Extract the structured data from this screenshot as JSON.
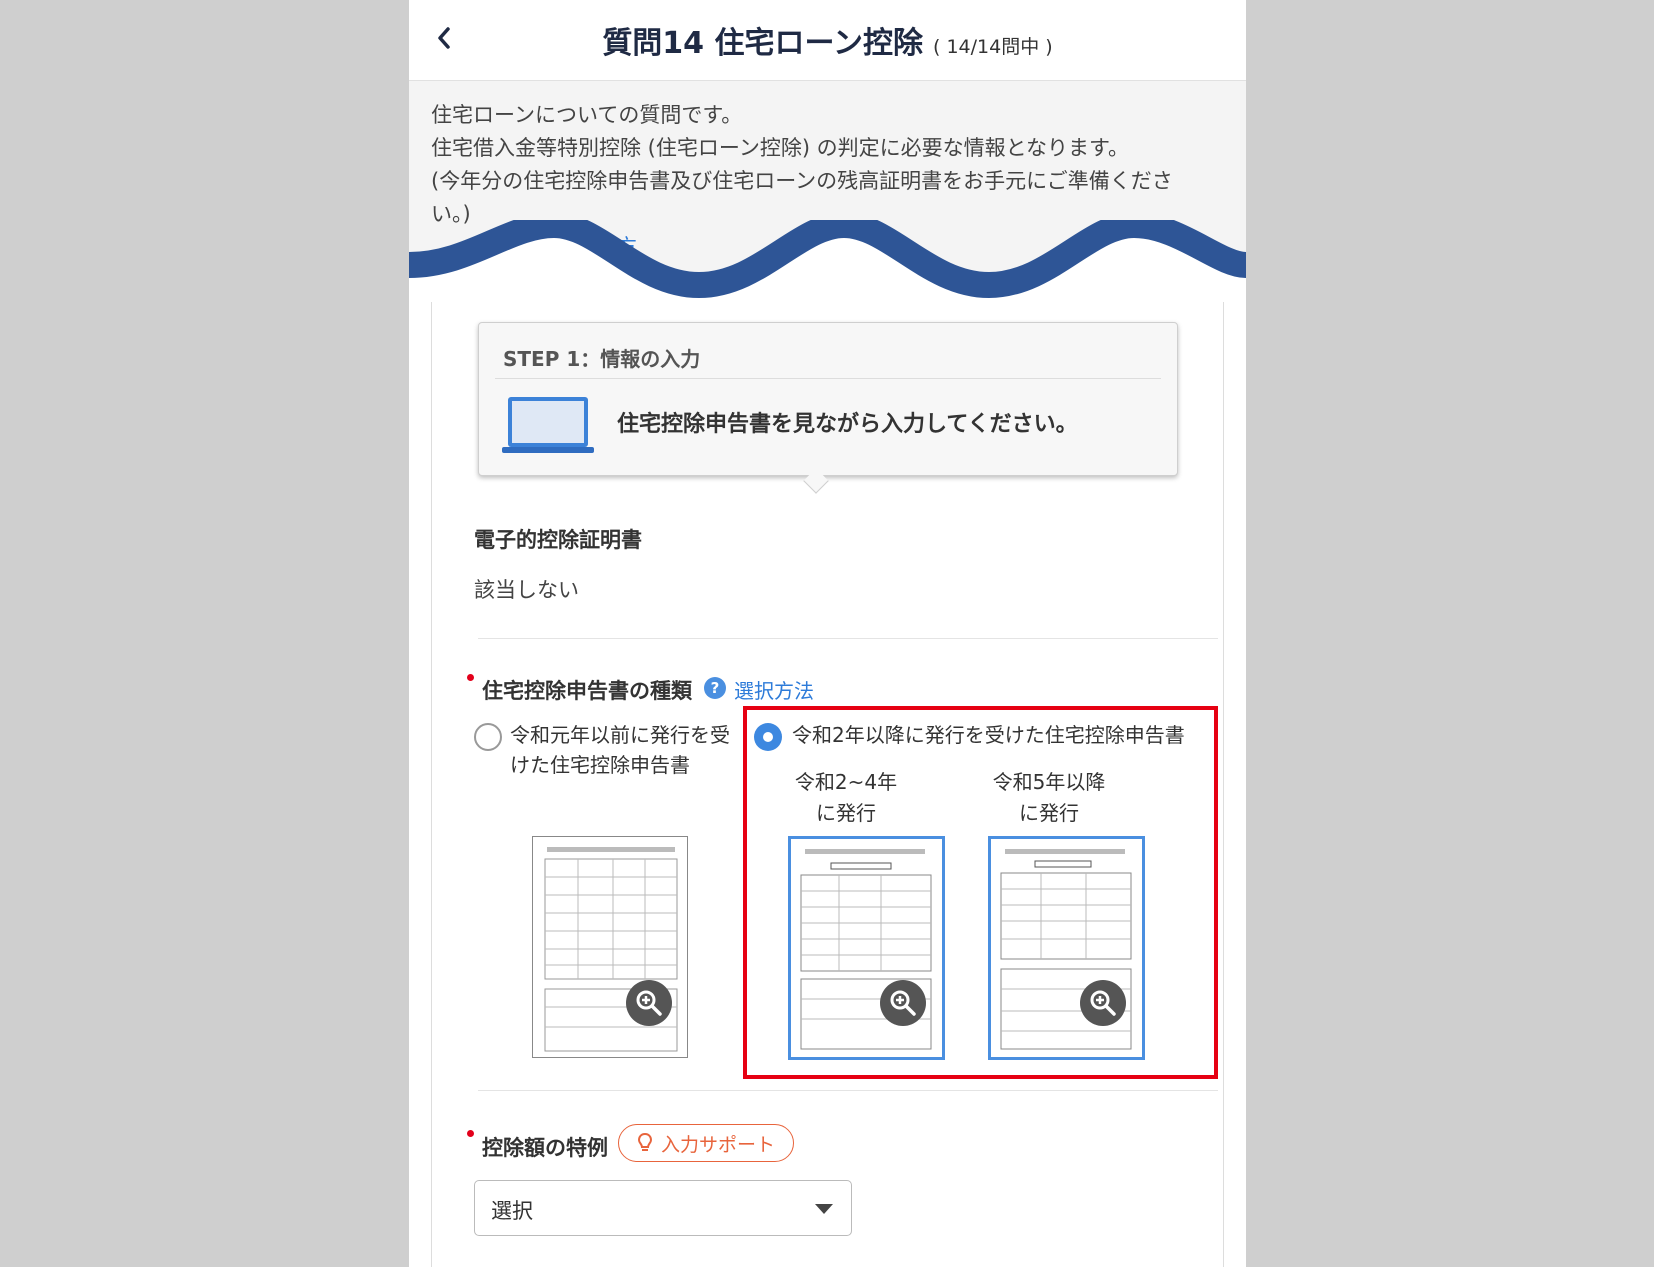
{
  "header": {
    "title": "質問14 住宅ローン控除",
    "progress": "( 14/14問中 )"
  },
  "intro": {
    "line1": "住宅ローンについての質問です。",
    "line2": "住宅借入金等特別控除 (住宅ローン控除) の判定に必要な情報となります。",
    "line3": "(今年分の住宅控除申告書及び住宅ローンの残高証明書をお手元にご準備くださ",
    "line4": "い。)",
    "link_partial": "に該当する方"
  },
  "step": {
    "heading": "STEP 1：情報の入力",
    "instruction": "住宅控除申告書を見ながら入力してください。"
  },
  "e_cert": {
    "label": "電子的控除証明書",
    "value": "該当しない"
  },
  "declaration_type": {
    "label": "住宅控除申告書の種類",
    "help_link": "選択方法",
    "options": [
      {
        "label_line1": "令和元年以前に発行を受",
        "label_line2": "けた住宅控除申告書",
        "selected": false
      },
      {
        "label": "令和2年以降に発行を受けた住宅控除申告書",
        "selected": true
      }
    ],
    "sub_captions": [
      {
        "line1": "令和2~4年",
        "line2": "に発行"
      },
      {
        "line1": "令和5年以降",
        "line2": "に発行"
      }
    ]
  },
  "deduction_special": {
    "label": "控除額の特例",
    "support_button": "入力サポート",
    "select_value": "選択"
  },
  "colors": {
    "accent": "#3d88e0",
    "link": "#2d7bd9",
    "wave": "#2e5596",
    "highlight_box": "#e60012",
    "required": "#e3001b",
    "support": "#e8643c"
  }
}
